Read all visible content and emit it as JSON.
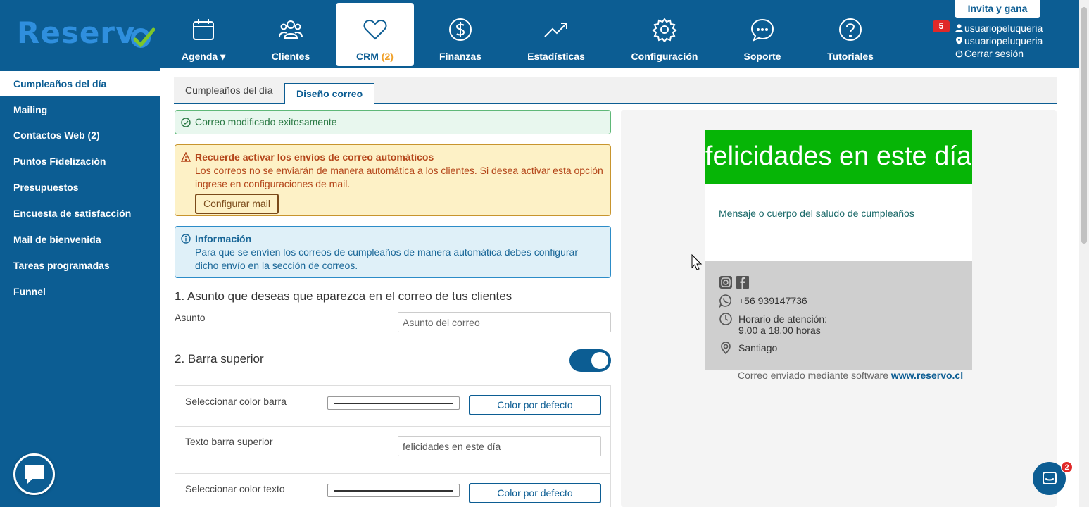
{
  "brand": {
    "logo_text": "Reserv",
    "logo_color": "#2f8fde",
    "check_color": "#7dc62a",
    "primary": "#0c5d93"
  },
  "nav": {
    "items": [
      {
        "label": "Agenda ▾",
        "icon": "calendar-icon"
      },
      {
        "label": "Clientes",
        "icon": "users-icon"
      },
      {
        "label": "CRM",
        "count": "(2)",
        "icon": "heart-icon",
        "active": true
      },
      {
        "label": "Finanzas",
        "icon": "dollar-icon"
      },
      {
        "label": "Estadísticas",
        "icon": "trending-up-icon"
      },
      {
        "label": "Configuración",
        "icon": "gear-icon"
      },
      {
        "label": "Soporte",
        "icon": "chat-icon"
      },
      {
        "label": "Tutoriales",
        "icon": "help-icon"
      }
    ]
  },
  "header_right": {
    "invite_label": "Invita y gana",
    "notifications": "5",
    "user": "usuariopeluqueria",
    "location": "usuariopeluqueria",
    "logout": "Cerrar sesión"
  },
  "sidebar": {
    "items": [
      {
        "label": "Cumpleaños del día",
        "active": true
      },
      {
        "label": "Mailing"
      },
      {
        "label": "Contactos Web (2)"
      },
      {
        "label": "Puntos Fidelización"
      },
      {
        "label": "Presupuestos"
      },
      {
        "label": "Encuesta de satisfacción"
      },
      {
        "label": "Mail de bienvenida"
      },
      {
        "label": "Tareas programadas"
      },
      {
        "label": "Funnel"
      }
    ]
  },
  "tabs": [
    {
      "label": "Cumpleaños del día"
    },
    {
      "label": "Diseño correo",
      "active": true
    }
  ],
  "alerts": {
    "success": "Correo modificado exitosamente",
    "warning": {
      "title": "Recuerde activar los envíos de correo automáticos",
      "body": "Los correos no se enviarán de manera automática a los clientes. Si desea activar esta opción ingrese en configuraciones de mail.",
      "button": "Configurar mail"
    },
    "info": {
      "title": "Información",
      "body": "Para que se envíen los correos de cumpleaños de manera automática debes configurar dicho envío en la sección de correos."
    }
  },
  "form": {
    "section1_title": "1. Asunto que deseas que aparezca en el correo de tus clientes",
    "subject_label": "Asunto",
    "subject_placeholder": "Asunto del correo",
    "section2_title": "2. Barra superior",
    "toggle_on": true,
    "bar_color_label": "Seleccionar color barra",
    "default_color_label": "Color por defecto",
    "bar_text_label": "Texto barra superior",
    "bar_text_value": "felicidades en este día",
    "text_color_label": "Seleccionar color texto",
    "default_color_label_2": "Color por defecto"
  },
  "preview": {
    "header_text": "felicidades en este día",
    "header_color": "#06b506",
    "body_text": "Mensaje o cuerpo del saludo de cumpleaños",
    "phone": "+56 939147736",
    "hours_label": "Horario de atención:",
    "hours_value": "9.00 a 18.00 horas",
    "city": "Santiago",
    "sent_by": "Correo enviado mediante software",
    "sent_by_link": "www.reservo.cl"
  },
  "help_badge": "2"
}
